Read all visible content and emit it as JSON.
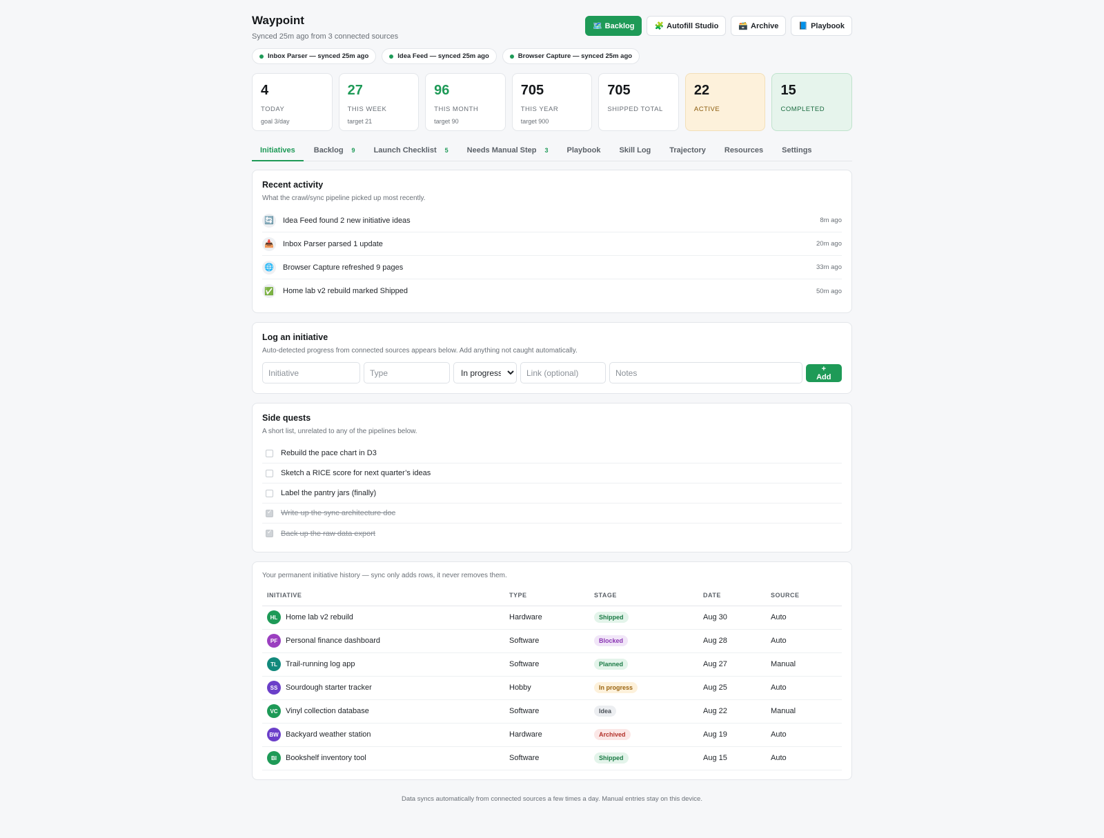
{
  "app": {
    "title": "Waypoint",
    "subtitle": "Synced 25m ago from 3 connected sources"
  },
  "header_buttons": [
    {
      "icon": "🗺️",
      "icon_name": "map-icon",
      "label": "Backlog",
      "primary": true
    },
    {
      "icon": "🧩",
      "icon_name": "puzzle-icon",
      "label": "Autofill Studio",
      "primary": false
    },
    {
      "icon": "🗃️",
      "icon_name": "card-file-box-icon",
      "label": "Archive",
      "primary": false
    },
    {
      "icon": "📘",
      "icon_name": "book-icon",
      "label": "Playbook",
      "primary": false
    }
  ],
  "sources": [
    {
      "label": "Inbox Parser — synced 25m ago"
    },
    {
      "label": "Idea Feed — synced 25m ago"
    },
    {
      "label": "Browser Capture — synced 25m ago"
    }
  ],
  "stats": [
    {
      "value": "4",
      "label": "TODAY",
      "sub": "goal 3/day",
      "style": "",
      "green": false
    },
    {
      "value": "27",
      "label": "THIS WEEK",
      "sub": "target 21",
      "style": "",
      "green": true
    },
    {
      "value": "96",
      "label": "THIS MONTH",
      "sub": "target 90",
      "style": "",
      "green": true
    },
    {
      "value": "705",
      "label": "THIS YEAR",
      "sub": "target 900",
      "style": "",
      "green": false
    },
    {
      "value": "705",
      "label": "SHIPPED TOTAL",
      "sub": "",
      "style": "",
      "green": false
    },
    {
      "value": "22",
      "label": "ACTIVE",
      "sub": "",
      "style": "active",
      "green": false
    },
    {
      "value": "15",
      "label": "COMPLETED",
      "sub": "",
      "style": "completed",
      "green": false
    }
  ],
  "tabs": [
    {
      "label": "Initiatives",
      "count": "",
      "active": true
    },
    {
      "label": "Backlog",
      "count": "9",
      "active": false
    },
    {
      "label": "Launch Checklist",
      "count": "5",
      "active": false
    },
    {
      "label": "Needs Manual Step",
      "count": "3",
      "active": false
    },
    {
      "label": "Playbook",
      "count": "",
      "active": false
    },
    {
      "label": "Skill Log",
      "count": "",
      "active": false
    },
    {
      "label": "Trajectory",
      "count": "",
      "active": false
    },
    {
      "label": "Resources",
      "count": "",
      "active": false
    },
    {
      "label": "Settings",
      "count": "",
      "active": false
    }
  ],
  "activity": {
    "title": "Recent activity",
    "desc": "What the crawl/sync pipeline picked up most recently.",
    "items": [
      {
        "icon": "🔄",
        "icon_name": "refresh-icon",
        "text": "Idea Feed found 2 new initiative ideas",
        "time": "8m ago"
      },
      {
        "icon": "📥",
        "icon_name": "inbox-tray-icon",
        "text": "Inbox Parser parsed 1 update",
        "time": "20m ago"
      },
      {
        "icon": "🌐",
        "icon_name": "globe-icon",
        "text": "Browser Capture refreshed 9 pages",
        "time": "33m ago"
      },
      {
        "icon": "✅",
        "icon_name": "check-mark-icon",
        "text": "Home lab v2 rebuild marked Shipped",
        "time": "50m ago"
      }
    ]
  },
  "log_form": {
    "title": "Log an initiative",
    "desc": "Auto-detected progress from connected sources appears below. Add anything not caught automatically.",
    "initiative_placeholder": "Initiative",
    "type_placeholder": "Type",
    "stage_value": "In progress",
    "link_placeholder": "Link (optional)",
    "notes_placeholder": "Notes",
    "add_label": "+ Add"
  },
  "side_quests": {
    "title": "Side quests",
    "desc": "A short list, unrelated to any of the pipelines below.",
    "items": [
      {
        "text": "Rebuild the pace chart in D3",
        "done": false
      },
      {
        "text": "Sketch a RICE score for next quarter’s ideas",
        "done": false
      },
      {
        "text": "Label the pantry jars (finally)",
        "done": false
      },
      {
        "text": "Write up the sync architecture doc",
        "done": true
      },
      {
        "text": "Back up the raw data export",
        "done": true
      }
    ]
  },
  "history": {
    "desc": "Your permanent initiative history — sync only adds rows, it never removes them.",
    "columns": [
      "INITIATIVE",
      "TYPE",
      "STAGE",
      "DATE",
      "SOURCE"
    ],
    "rows": [
      {
        "initials": "HL",
        "avatar_color": "#1e9a57",
        "name": "Home lab v2 rebuild",
        "type": "Hardware",
        "stage": "Shipped",
        "date": "Aug 30",
        "source": "Auto"
      },
      {
        "initials": "PF",
        "avatar_color": "#9b3fc0",
        "name": "Personal finance dashboard",
        "type": "Software",
        "stage": "Blocked",
        "date": "Aug 28",
        "source": "Auto"
      },
      {
        "initials": "TL",
        "avatar_color": "#12897c",
        "name": "Trail-running log app",
        "type": "Software",
        "stage": "Planned",
        "date": "Aug 27",
        "source": "Manual"
      },
      {
        "initials": "SS",
        "avatar_color": "#6b3fc9",
        "name": "Sourdough starter tracker",
        "type": "Hobby",
        "stage": "In progress",
        "date": "Aug 25",
        "source": "Auto"
      },
      {
        "initials": "VC",
        "avatar_color": "#1e9a57",
        "name": "Vinyl collection database",
        "type": "Software",
        "stage": "Idea",
        "date": "Aug 22",
        "source": "Manual"
      },
      {
        "initials": "BW",
        "avatar_color": "#6b3fc9",
        "name": "Backyard weather station",
        "type": "Hardware",
        "stage": "Archived",
        "date": "Aug 19",
        "source": "Auto"
      },
      {
        "initials": "BI",
        "avatar_color": "#1e9a57",
        "name": "Bookshelf inventory tool",
        "type": "Software",
        "stage": "Shipped",
        "date": "Aug 15",
        "source": "Auto"
      }
    ]
  },
  "stage_colors": {
    "Shipped": {
      "bg": "#e3f4ea",
      "fg": "#1a7a45"
    },
    "Blocked": {
      "bg": "#f1e6f8",
      "fg": "#8a35b3"
    },
    "Planned": {
      "bg": "#e3f4ea",
      "fg": "#1a7a45"
    },
    "In progress": {
      "bg": "#fdf1db",
      "fg": "#9a6410"
    },
    "Idea": {
      "bg": "#eceef1",
      "fg": "#4b5158"
    },
    "Archived": {
      "bg": "#fbe7e6",
      "fg": "#b3322b"
    }
  },
  "footer": "Data syncs automatically from connected sources a few times a day. Manual entries stay on this device."
}
